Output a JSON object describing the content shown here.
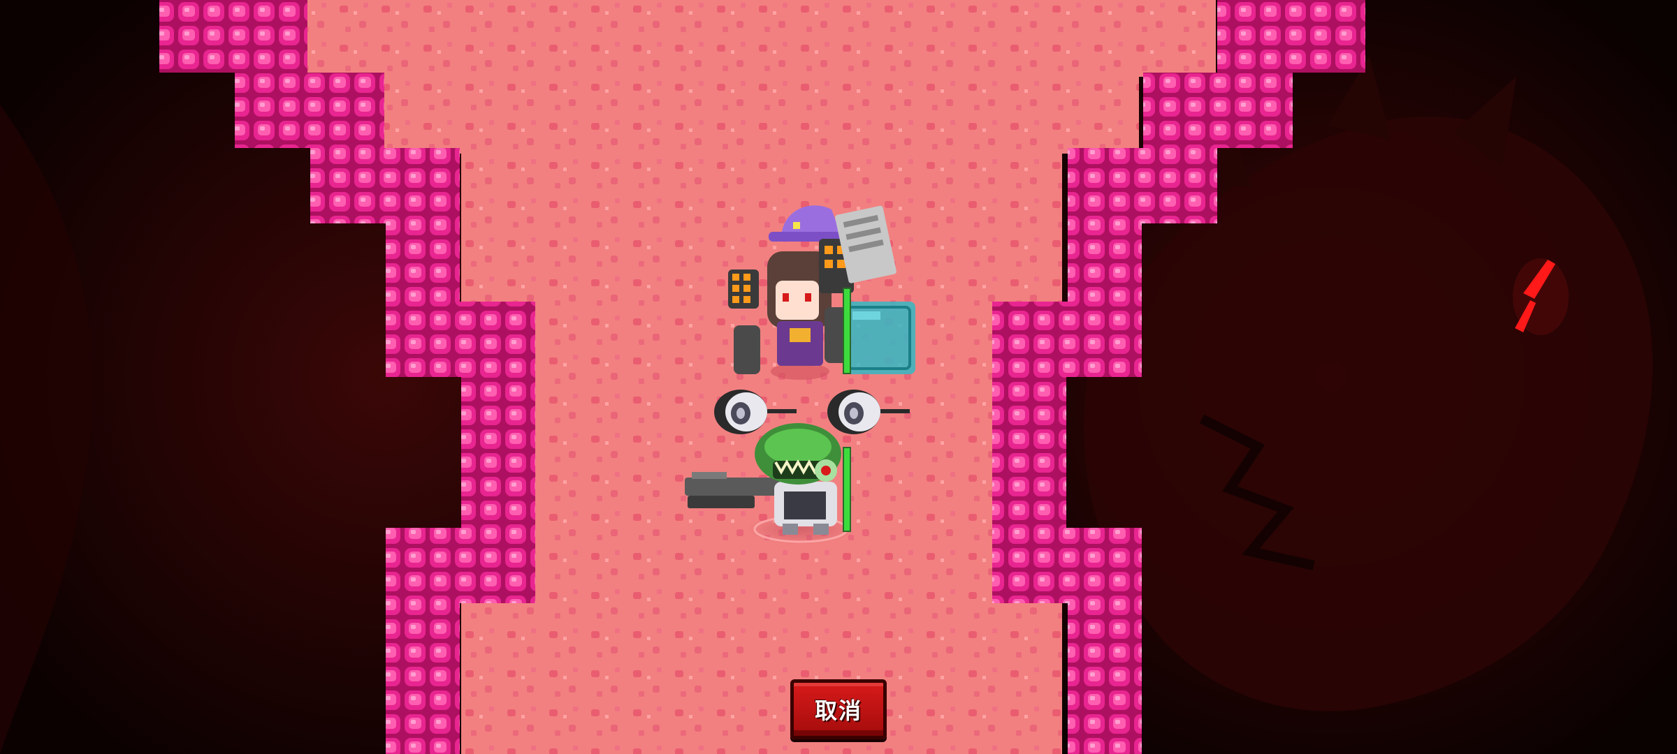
{
  "controls": {
    "cancel_label": "取消"
  },
  "colors": {
    "cave_wall": "#1a0505",
    "floor": "#f07c7c",
    "crystal": "#e6208e",
    "cancel_button": "#c41212",
    "shield": "#34b9c4",
    "health_bar": "#3ddc3d",
    "boss_eye": "#ff1a1a"
  },
  "scene": {
    "icons": [
      "boss-shadow-icon",
      "witch-hero-icon",
      "mech-companion-icon",
      "crocodile-gunner-icon",
      "shield-block-icon",
      "health-bar-icon"
    ]
  }
}
